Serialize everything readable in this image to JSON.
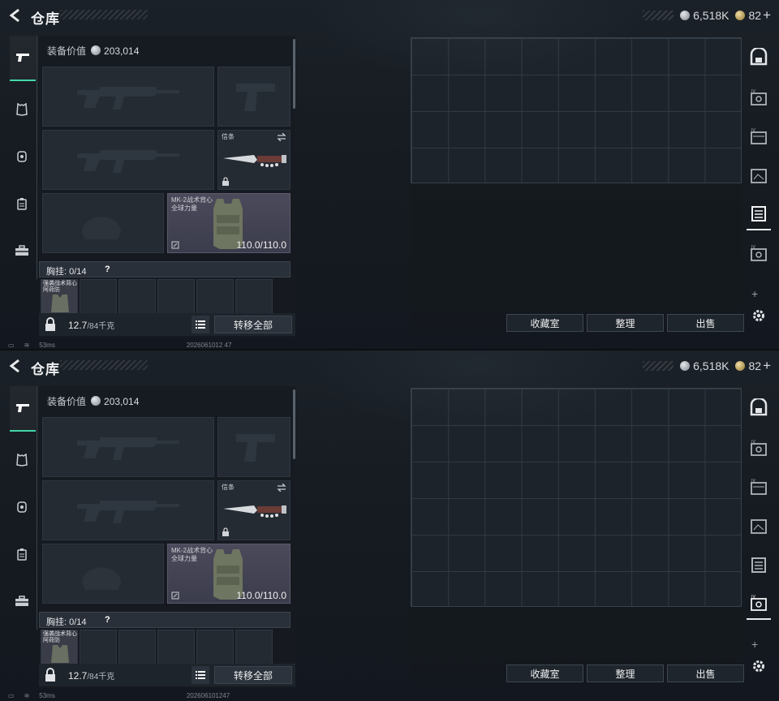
{
  "screens": [
    {
      "header": {
        "title": "仓库",
        "silver": "6,518K",
        "gold": "82",
        "plus": "+"
      },
      "loadout": {
        "equip_value_label": "装备价值",
        "equip_value": "203,014",
        "melee_label": "信条",
        "vest_name": "MK-2战术背心",
        "vest_sub": "全球力量",
        "vest_durability": "110.0/110.0",
        "rig_label": "胸挂:",
        "rig_count": "0/14",
        "rig_help": "?",
        "rig_item_label": "强袭战术背心",
        "rig_item_sub": "阿荷防",
        "weight": "12.7",
        "weight_max": "/84千克",
        "transfer_all": "转移全部"
      },
      "stash": {
        "collection": "收藏室",
        "organize": "整理",
        "sell": "出售"
      },
      "right_rail_selected": 3,
      "status": {
        "ping": "53ms",
        "uid": "2026061012 47"
      }
    },
    {
      "header": {
        "title": "仓库",
        "silver": "6,518K",
        "gold": "82",
        "plus": "+"
      },
      "loadout": {
        "equip_value_label": "装备价值",
        "equip_value": "203,014",
        "melee_label": "信条",
        "vest_name": "MK-2战术背心",
        "vest_sub": "全球力量",
        "vest_durability": "110.0/110.0",
        "rig_label": "胸挂:",
        "rig_count": "0/14",
        "rig_help": "?",
        "rig_item_label": "强袭战术背心",
        "rig_item_sub": "阿荷防",
        "weight": "12.7",
        "weight_max": "/84千克",
        "transfer_all": "转移全部"
      },
      "stash": {
        "collection": "收藏室",
        "organize": "整理",
        "sell": "出售"
      },
      "right_rail_selected": 5,
      "status": {
        "ping": "53ms",
        "uid": "202606101247"
      }
    }
  ],
  "icons": {
    "back": "back-arrow-icon",
    "left_rail": [
      "pistol-icon",
      "armor-icon",
      "helmet-icon",
      "backpack-icon",
      "toolbox-icon"
    ],
    "right_rail": [
      "safe-icon",
      "container-icon",
      "container-icon",
      "container-icon",
      "container-icon",
      "container-icon"
    ]
  },
  "colors": {
    "accent": "#42d7a6",
    "vest_bg": "#4b4a5b",
    "background": "#161b21"
  }
}
